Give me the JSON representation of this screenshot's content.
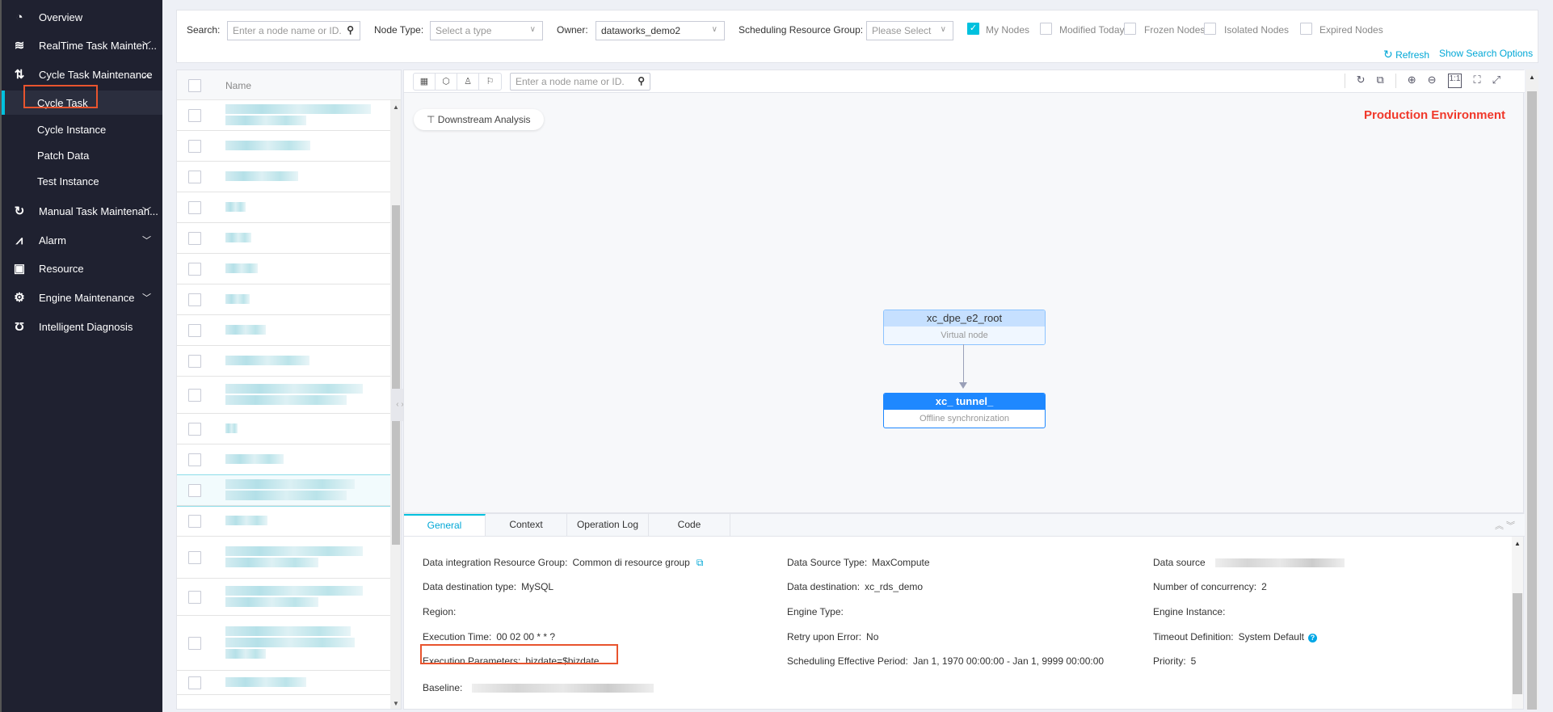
{
  "sidebar": {
    "items": [
      {
        "label": "Overview",
        "icon": "pie-chart-icon"
      },
      {
        "label": "RealTime Task Mainten...",
        "icon": "stream-icon"
      },
      {
        "label": "Cycle Task Maintenance",
        "icon": "cycle-icon"
      },
      {
        "label": "Cycle Task"
      },
      {
        "label": "Cycle Instance"
      },
      {
        "label": "Patch Data"
      },
      {
        "label": "Test Instance"
      },
      {
        "label": "Manual Task Maintenan...",
        "icon": "manual-icon"
      },
      {
        "label": "Alarm",
        "icon": "alarm-icon"
      },
      {
        "label": "Resource",
        "icon": "resource-icon"
      },
      {
        "label": "Engine Maintenance",
        "icon": "chip-icon"
      },
      {
        "label": "Intelligent Diagnosis",
        "icon": "stethoscope-icon"
      }
    ]
  },
  "filters": {
    "search_label": "Search:",
    "search_placeholder": "Enter a node name or ID.",
    "node_type_label": "Node Type:",
    "node_type_placeholder": "Select a type",
    "owner_label": "Owner:",
    "owner_value": "dataworks_demo2",
    "resource_group_label": "Scheduling Resource Group:",
    "resource_group_placeholder": "Please Select",
    "checkboxes": [
      {
        "label": "My Nodes",
        "checked": true
      },
      {
        "label": "Modified Today",
        "checked": false
      },
      {
        "label": "Frozen Nodes",
        "checked": false
      },
      {
        "label": "Isolated Nodes",
        "checked": false
      },
      {
        "label": "Expired Nodes",
        "checked": false
      }
    ],
    "refresh": "Refresh",
    "show_search_options": "Show Search Options"
  },
  "list": {
    "header_name": "Name"
  },
  "graph": {
    "search_placeholder": "Enter a node name or ID.",
    "downstream_analysis": "Downstream Analysis",
    "environment": "Production Environment",
    "nodes": [
      {
        "name": "xc_dpe_e2_root",
        "type": "Virtual node"
      },
      {
        "name": "xc_          tunnel_",
        "type": "Offline synchronization"
      }
    ]
  },
  "detail": {
    "tabs": [
      "General",
      "Context",
      "Operation Log",
      "Code"
    ],
    "col1": [
      {
        "label": "Data integration Resource Group:",
        "value": "Common di resource group"
      },
      {
        "label": "Data destination type:",
        "value": "MySQL"
      },
      {
        "label": "Region:",
        "value": ""
      },
      {
        "label": "Execution Time:",
        "value": "00 02 00 * * ?"
      },
      {
        "label": "Execution Parameters:",
        "value": "bizdate=$bizdate"
      },
      {
        "label": "Baseline:",
        "value": ""
      }
    ],
    "col2": [
      {
        "label": "Data Source Type:",
        "value": "MaxCompute"
      },
      {
        "label": "Data destination:",
        "value": "xc_rds_demo"
      },
      {
        "label": "Engine Type:",
        "value": ""
      },
      {
        "label": "Retry upon Error:",
        "value": "No"
      },
      {
        "label": "Scheduling Effective Period:",
        "value": "Jan 1, 1970 00:00:00 - Jan 1, 9999 00:00:00"
      }
    ],
    "col3": [
      {
        "label": "Data source",
        "value": ""
      },
      {
        "label": "Number of concurrency:",
        "value": "2"
      },
      {
        "label": "Engine Instance:",
        "value": ""
      },
      {
        "label": "Timeout Definition:",
        "value": "System Default"
      },
      {
        "label": "Priority:",
        "value": "5"
      }
    ]
  },
  "colors": {
    "accent": "#00c1de",
    "sidebar": "#1f2130",
    "highlight": "#e8542e",
    "env": "#f0392b",
    "node": "#1e88ff"
  }
}
